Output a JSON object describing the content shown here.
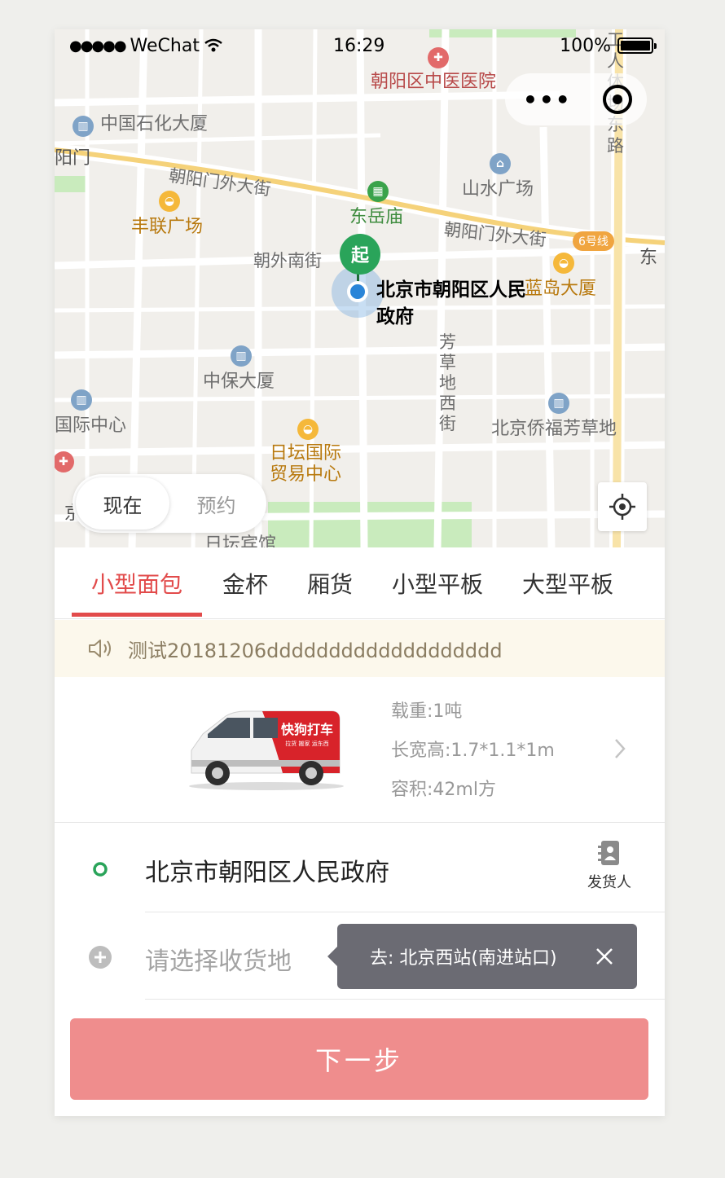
{
  "status_bar": {
    "signal": "●●●●●",
    "carrier": "WeChat",
    "time": "16:29",
    "battery": "100%"
  },
  "map": {
    "pois": {
      "hospital": "朝阳区中医医院",
      "sinopec": "中国石化大厦",
      "chaoyangmen": "阳门",
      "fenglian": "丰联广场",
      "dongyuemiao": "东岳庙",
      "shanshui": "山水广场",
      "lando": "蓝岛大厦",
      "zhongbao": "中保大厦",
      "intl_center": "国际中心",
      "ritan_trade": "日坛国际\n贸易中心",
      "qiaofu": "北京侨福芳草地",
      "ritan_hotel": "日坛宾馆",
      "dong": "东",
      "jing": "京"
    },
    "roads": {
      "chaoyangmenwai_1": "朝阳门外大街",
      "chaoyangmenwai_2": "朝阳门外大街",
      "chaowai_south": "朝外南街",
      "fangcaodi": "芳\n草\n地\n西\n街",
      "east_road": "工\n人\n体\n场\n东\n路"
    },
    "metro_line": "6号线",
    "origin_badge": "起",
    "origin_label": "北京市朝阳区人民政府"
  },
  "time_toggle": {
    "now": "现在",
    "reserve": "预约"
  },
  "tabs": [
    "小型面包",
    "金杯",
    "厢货",
    "小型平板",
    "大型平板"
  ],
  "active_tab": 0,
  "notice": "测试20181206ddddddddddddddddddd",
  "vehicle": {
    "brand": "快狗打车",
    "brand_sub": "拉货 搬家 运东西",
    "load": "载重:1吨",
    "dimensions": "长宽高:1.7*1.1*1m",
    "volume": "容积:42ml方"
  },
  "pickup": {
    "address": "北京市朝阳区人民政府",
    "shipper_label": "发货人"
  },
  "dropoff": {
    "placeholder": "请选择收货地",
    "suggestion": "去: 北京西站(南进站口)"
  },
  "next_button": "下一步",
  "colors": {
    "accent_red": "#e24b4b",
    "button_pink": "#ef8d8d",
    "notice_bg": "#fcf8ec",
    "origin_green": "#2aa45a"
  }
}
